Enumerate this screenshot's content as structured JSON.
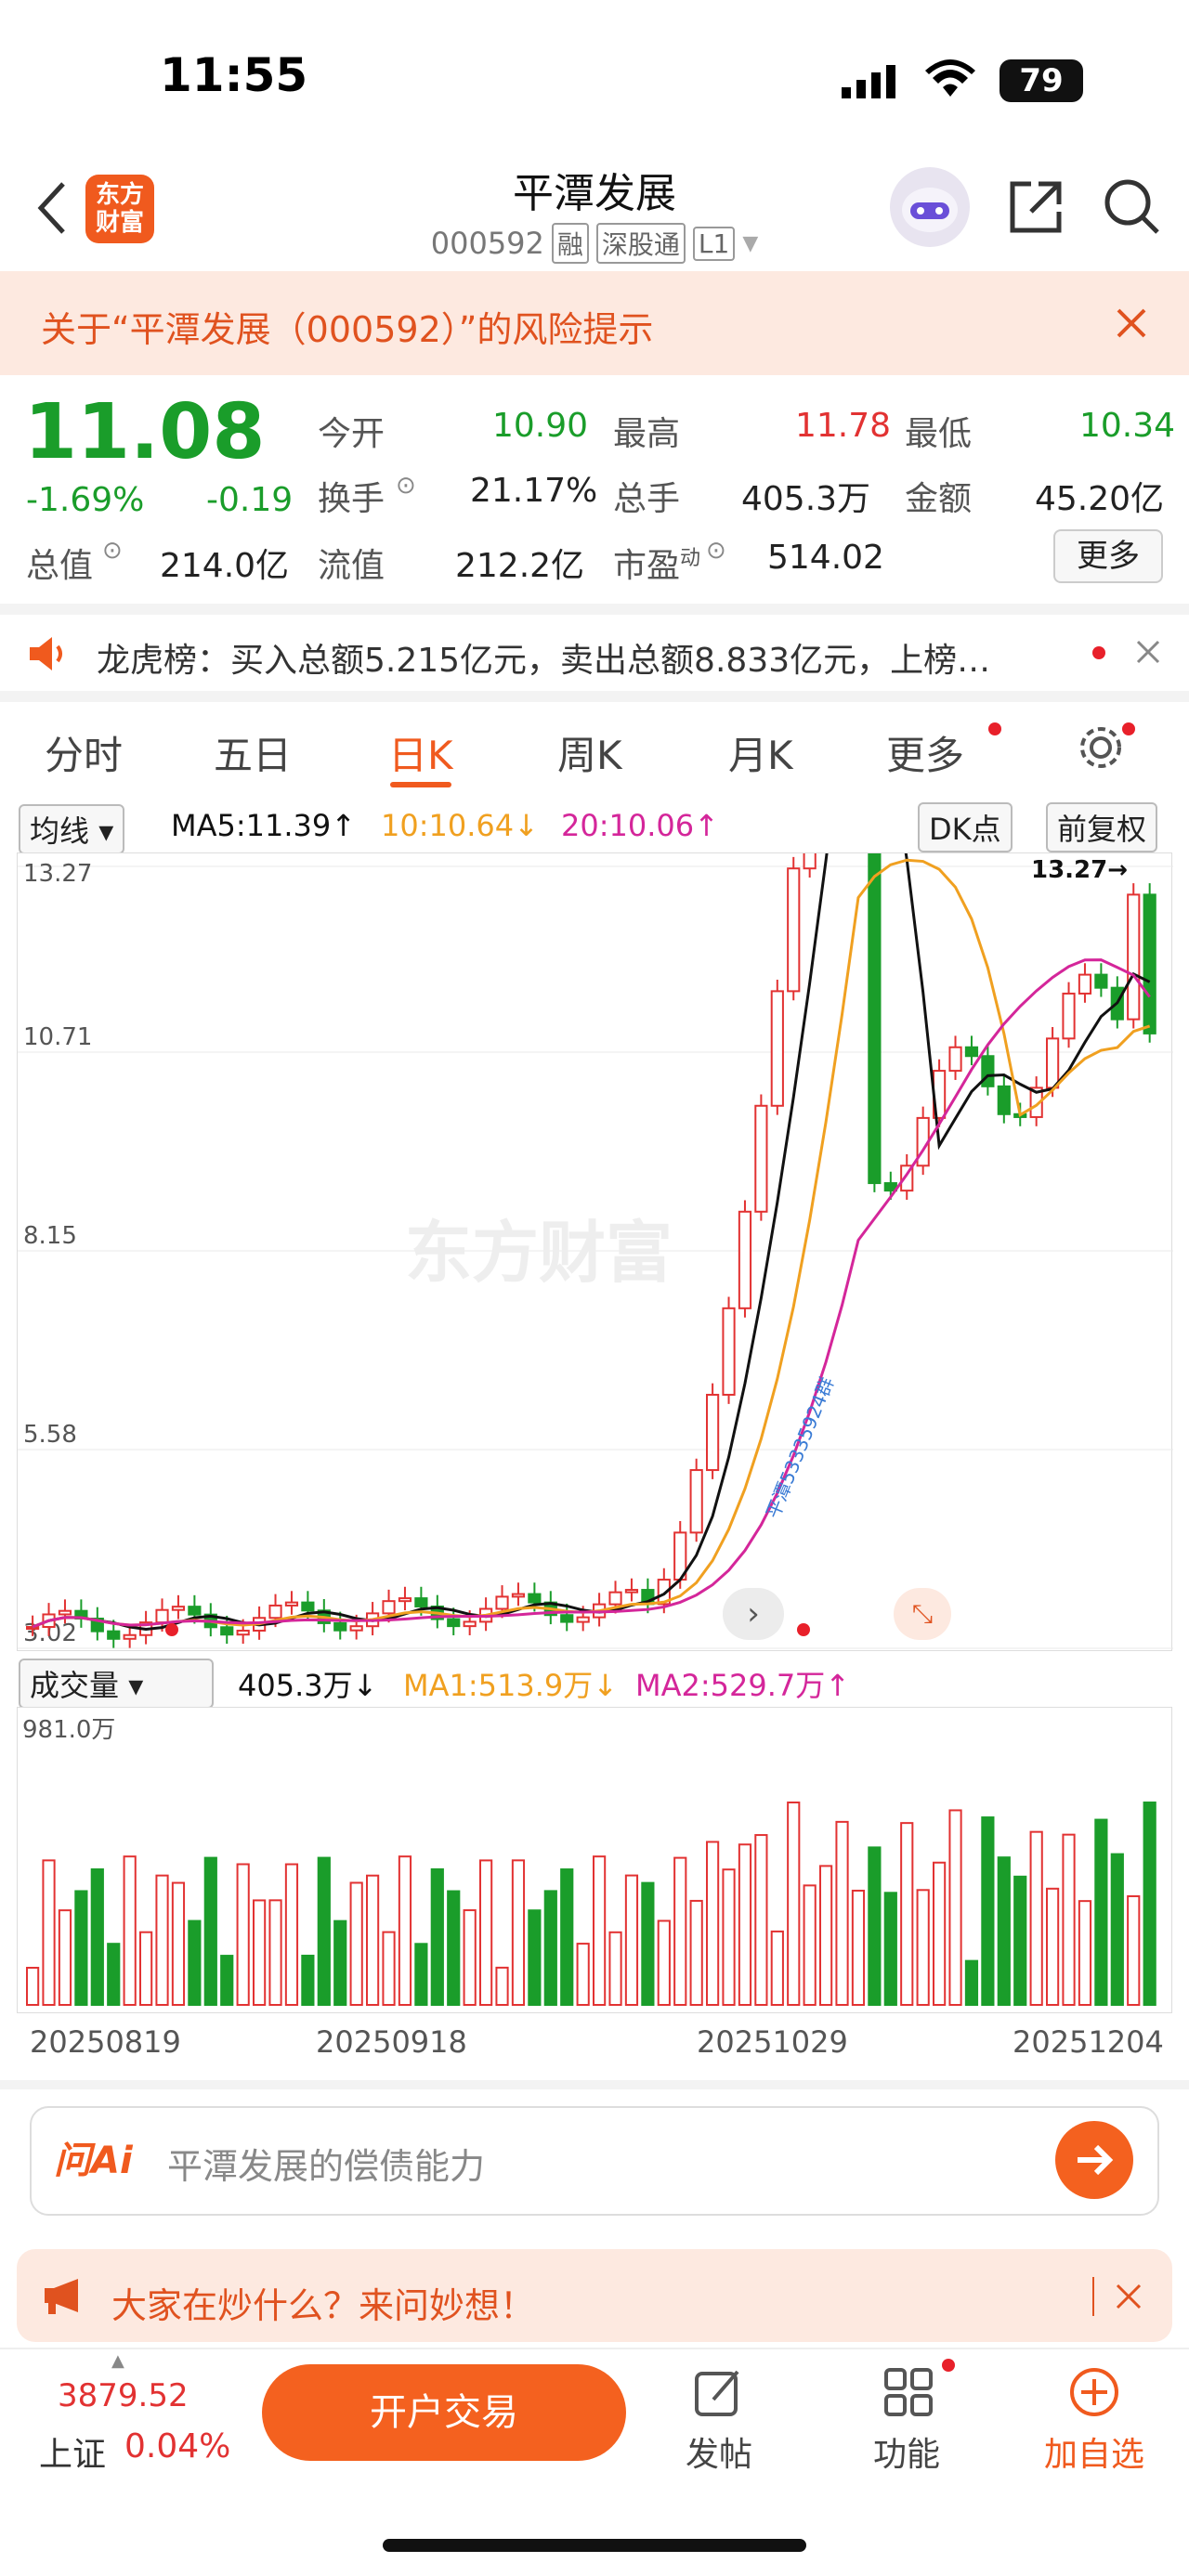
{
  "status": {
    "time": "11:55",
    "battery": "79"
  },
  "header": {
    "title": "平潭发展",
    "code": "000592",
    "tags": [
      "融",
      "深股通",
      "L1"
    ],
    "logo_text_1": "东方",
    "logo_text_2": "财富"
  },
  "risk_banner": {
    "text": "关于“平潭发展（000592）”的风险提示"
  },
  "quote": {
    "price": "11.08",
    "change_pct": "-1.69%",
    "change": "-0.19",
    "open_label": "今开",
    "open": "10.90",
    "high_label": "最高",
    "high": "11.78",
    "low_label": "最低",
    "low": "10.34",
    "turnover_label": "换手",
    "turnover": "21.17%",
    "volume_label": "总手",
    "volume": "405.3万",
    "amount_label": "金额",
    "amount": "45.20亿",
    "mktcap_label": "总值",
    "mktcap": "214.0亿",
    "float_label": "流值",
    "float": "212.2亿",
    "pe_label": "市盈",
    "pe_sup": "动",
    "pe": "514.02",
    "more": "更多"
  },
  "dragon_tiger": {
    "text": "龙虎榜：买入总额5.215亿元，卖出总额8.833亿元，上榜…"
  },
  "tabs": [
    "分时",
    "五日",
    "日K",
    "周K",
    "月K",
    "更多"
  ],
  "kline": {
    "indicator": "均线",
    "ma5": "MA5:11.39",
    "ma10": "10:10.64",
    "ma20": "20:10.06",
    "dk": "DK点",
    "adjust": "前复权",
    "y_labels": [
      "13.27",
      "10.71",
      "8.15",
      "5.58",
      "3.02"
    ],
    "max_label": "13.27",
    "watermark": "东方财富",
    "annotation": "平潭53335924群"
  },
  "volume": {
    "indicator": "成交量",
    "value": "405.3万",
    "ma1": "MA1:513.9万",
    "ma2": "MA2:529.7万",
    "max_label": "981.0万",
    "dates": [
      "20250819",
      "20250918",
      "20251029",
      "20251204"
    ]
  },
  "ask_ai": {
    "brand": "问Ai",
    "placeholder": "平潭发展的偿债能力"
  },
  "hot_banner": {
    "text": "大家在炒什么？来问妙想！"
  },
  "bottom": {
    "index_value": "3879.52",
    "index_name": "上证",
    "index_change": "0.04%",
    "trade": "开户交易",
    "post": "发帖",
    "functions": "功能",
    "add": "加自选"
  },
  "colors": {
    "up": "#e23232",
    "down": "#1a9d2a",
    "ma5": "#111111",
    "ma10": "#f0a020",
    "ma20": "#d4269a",
    "accent": "#f05a1e"
  }
}
